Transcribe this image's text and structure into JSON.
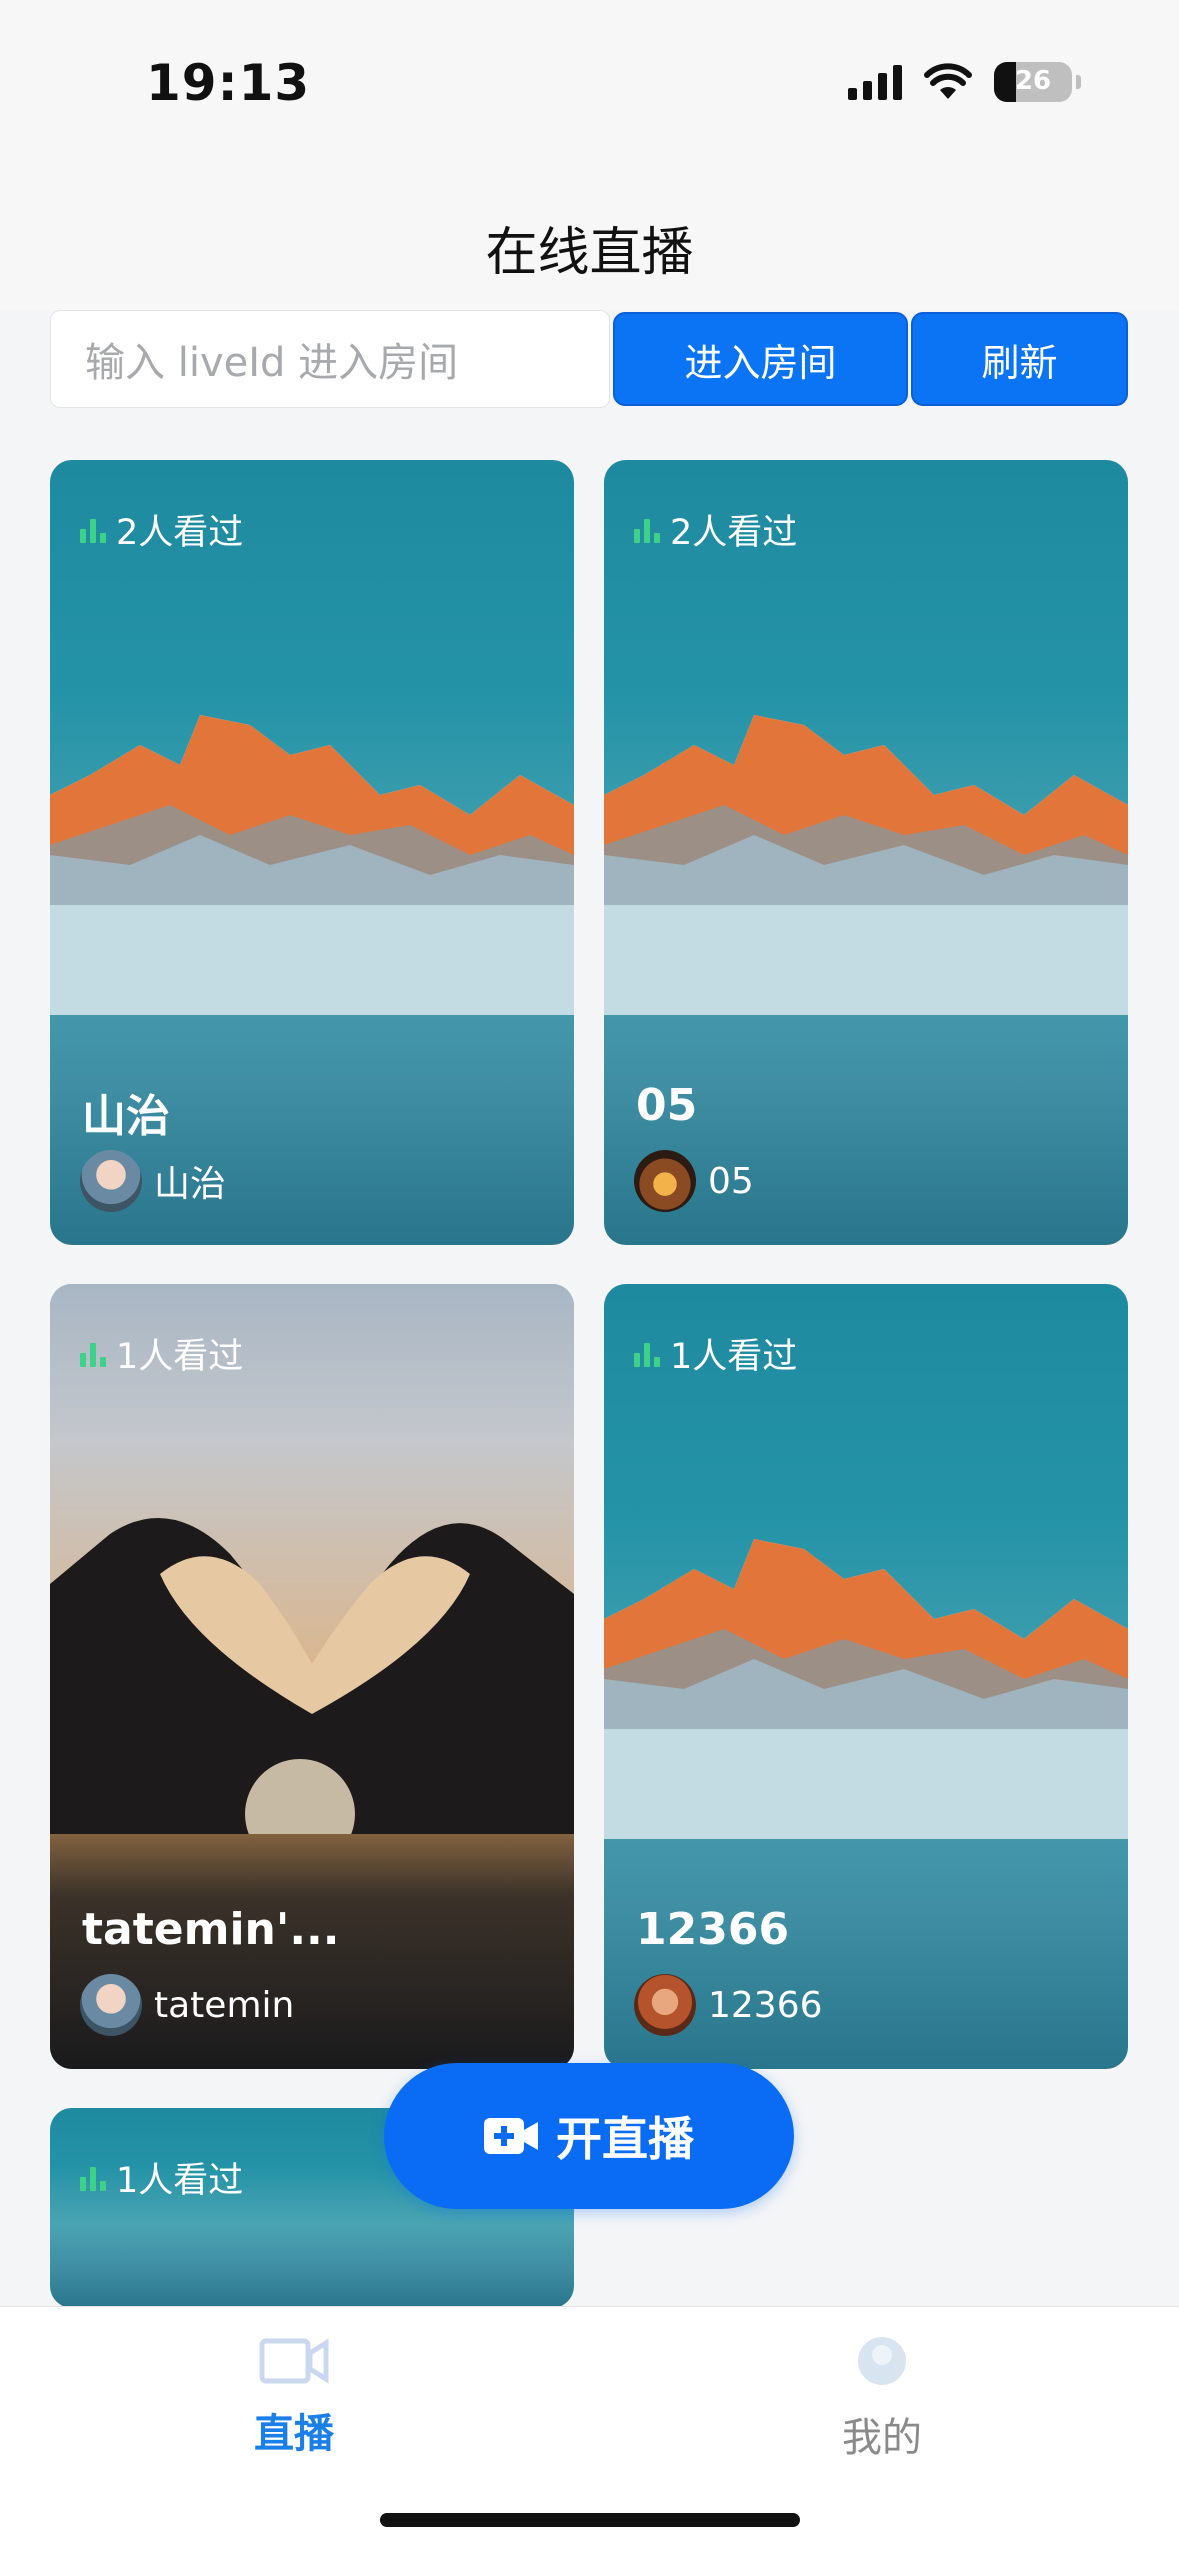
{
  "status_bar": {
    "time": "19:13",
    "battery": "26"
  },
  "nav": {
    "title": "在线直播"
  },
  "search": {
    "placeholder": "输入 liveId 进入房间",
    "enter_label": "进入房间",
    "refresh_label": "刷新"
  },
  "cards": [
    {
      "views": "2人看过",
      "title": "山治",
      "host": "山治",
      "cover": "mountain-lake"
    },
    {
      "views": "2人看过",
      "title": "05",
      "host": "05",
      "cover": "mountain-lake"
    },
    {
      "views": "1人看过",
      "title": "tatemin'...",
      "host": "tatemin",
      "cover": "heart-hands-sunset"
    },
    {
      "views": "1人看过",
      "title": "12366",
      "host": "12366",
      "cover": "mountain-lake"
    },
    {
      "views": "1人看过",
      "cover": "mountain-lake"
    }
  ],
  "fab": {
    "label": "开直播",
    "icon": "video-plus-icon"
  },
  "tabbar": {
    "items": [
      {
        "label": "直播",
        "icon": "video-camera-icon",
        "active": true
      },
      {
        "label": "我的",
        "icon": "avatar-icon",
        "active": false
      }
    ]
  },
  "colors": {
    "accent": "#0a74f5",
    "tab_active": "#1a7fe8",
    "views_bar": "#3ed18a"
  }
}
